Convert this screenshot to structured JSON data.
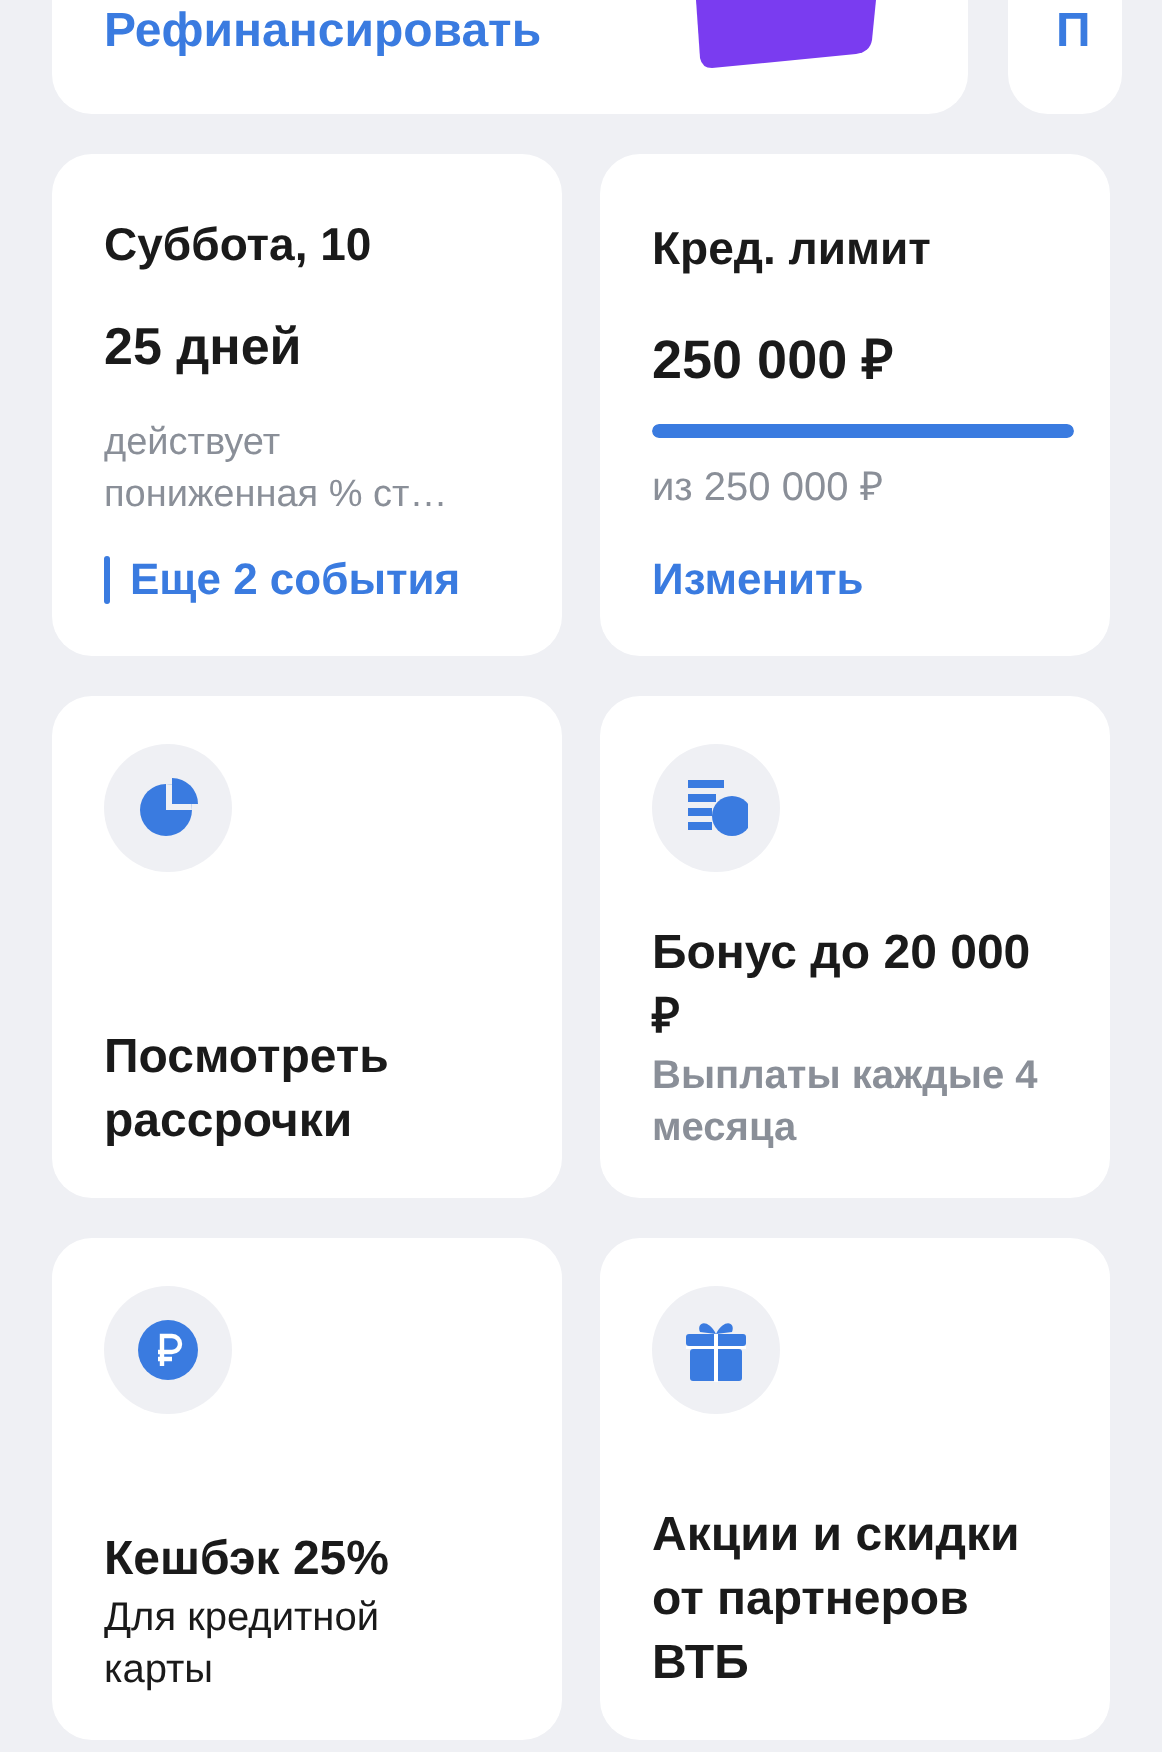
{
  "top_strip": {
    "refinance_link": "Рефинансировать",
    "next_card_title": "П"
  },
  "card_rows": [
    {
      "cards": [
        {
          "kind": "calendar",
          "date": "Суббота, 10",
          "days": "25 дней",
          "description_lines": [
            "действует",
            "пониженная % ст…"
          ],
          "events_link": "Еще 2 события"
        },
        {
          "kind": "limit",
          "title": "Кред. лимит",
          "amount": "250 000 ₽",
          "level": 1,
          "total": "из 250 000 ₽",
          "change_link": "Изменить"
        }
      ]
    },
    {
      "cards": [
        {
          "kind": "installments",
          "title_lines": [
            "Посмотреть",
            "рассрочки"
          ]
        },
        {
          "kind": "bonus",
          "title_lines": [
            "Бонус до 20 000",
            "₽"
          ],
          "subtitle_lines": [
            "Выплаты каждые 4",
            "месяца"
          ]
        }
      ]
    },
    {
      "cards": [
        {
          "kind": "cashback",
          "title_lines": [
            "Кешбэк 25%"
          ],
          "subtitle_lines": [
            "Для кредитной",
            "карты"
          ]
        },
        {
          "kind": "offers",
          "title_lines": [
            "Акции и скидки",
            "от партнеров",
            "ВТБ"
          ]
        }
      ]
    }
  ]
}
